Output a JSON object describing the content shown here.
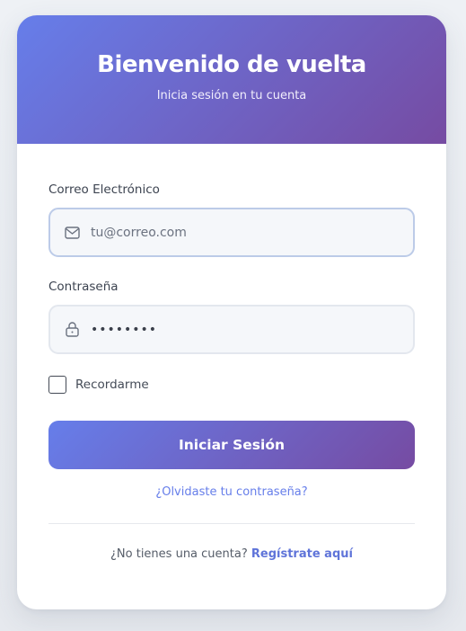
{
  "header": {
    "title": "Bienvenido de vuelta",
    "subtitle": "Inicia sesión en tu cuenta"
  },
  "email": {
    "label": "Correo Electrónico",
    "placeholder": "tu@correo.com",
    "icon": "envelope-icon"
  },
  "password": {
    "label": "Contraseña",
    "masked_value": "••••••••",
    "icon": "lock-icon"
  },
  "remember": {
    "label": "Recordarme",
    "checked": false
  },
  "submit": {
    "label": "Iniciar Sesión"
  },
  "forgot": {
    "label": "¿Olvidaste tu contraseña?"
  },
  "signup": {
    "prompt": "¿No tienes una cuenta?",
    "link": "Regístrate aquí"
  },
  "colors": {
    "gradient_start": "#667eea",
    "gradient_end": "#764ba2",
    "link": "#667eea"
  }
}
